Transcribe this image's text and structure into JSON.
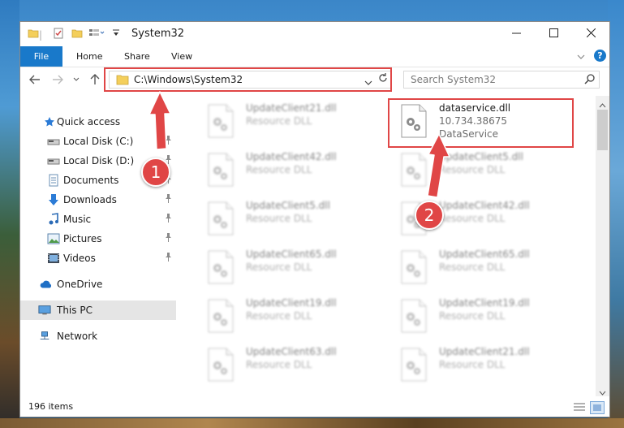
{
  "window": {
    "title": "System32",
    "minimize_icon": "minimize-icon",
    "maximize_icon": "maximize-icon",
    "close_icon": "close-icon"
  },
  "ribbon": {
    "tabs": [
      "File",
      "Home",
      "Share",
      "View"
    ],
    "help_label": "?"
  },
  "navigation": {
    "address": "C:\\Windows\\System32",
    "search_placeholder": "Search System32"
  },
  "sidebar": {
    "items": [
      {
        "label": "Quick access",
        "icon": "star-icon",
        "pinned": false
      },
      {
        "label": "Local Disk (C:)",
        "icon": "drive-icon",
        "pinned": true
      },
      {
        "label": "Local Disk (D:)",
        "icon": "drive-icon",
        "pinned": true
      },
      {
        "label": "Documents",
        "icon": "documents-icon",
        "pinned": true
      },
      {
        "label": "Downloads",
        "icon": "download-icon",
        "pinned": true
      },
      {
        "label": "Music",
        "icon": "music-icon",
        "pinned": true
      },
      {
        "label": "Pictures",
        "icon": "pictures-icon",
        "pinned": true
      },
      {
        "label": "Videos",
        "icon": "videos-icon",
        "pinned": true
      },
      {
        "label": "OneDrive",
        "icon": "cloud-icon",
        "pinned": false
      },
      {
        "label": "This PC",
        "icon": "computer-icon",
        "pinned": false,
        "selected": true
      },
      {
        "label": "Network",
        "icon": "network-icon",
        "pinned": false
      }
    ]
  },
  "files": {
    "left": [
      {
        "name": "UpdateClient21.dll",
        "type": "Resource DLL"
      },
      {
        "name": "UpdateClient42.dll",
        "type": "Resource DLL"
      },
      {
        "name": "UpdateClient5.dll",
        "type": "Resource DLL"
      },
      {
        "name": "UpdateClient65.dll",
        "type": "Resource DLL"
      },
      {
        "name": "UpdateClient19.dll",
        "type": "Resource DLL"
      },
      {
        "name": "UpdateClient63.dll",
        "type": "Resource DLL"
      }
    ],
    "right": [
      {
        "name": "dataservice.dll",
        "version": "10.734.38675",
        "type": "DataService",
        "highlighted": true
      },
      {
        "name": "UpdateClient5.dll",
        "type": "Resource DLL"
      },
      {
        "name": "UpdateClient42.dll",
        "type": "Resource DLL"
      },
      {
        "name": "UpdateClient65.dll",
        "type": "Resource DLL"
      },
      {
        "name": "UpdateClient19.dll",
        "type": "Resource DLL"
      },
      {
        "name": "UpdateClient21.dll",
        "type": "Resource DLL"
      }
    ]
  },
  "status": {
    "item_count": "196 items"
  },
  "callouts": [
    {
      "number": "1",
      "target": "address-bar"
    },
    {
      "number": "2",
      "target": "dataservice.dll"
    }
  ],
  "colors": {
    "accent": "#1979ca",
    "callout": "#e04646"
  }
}
